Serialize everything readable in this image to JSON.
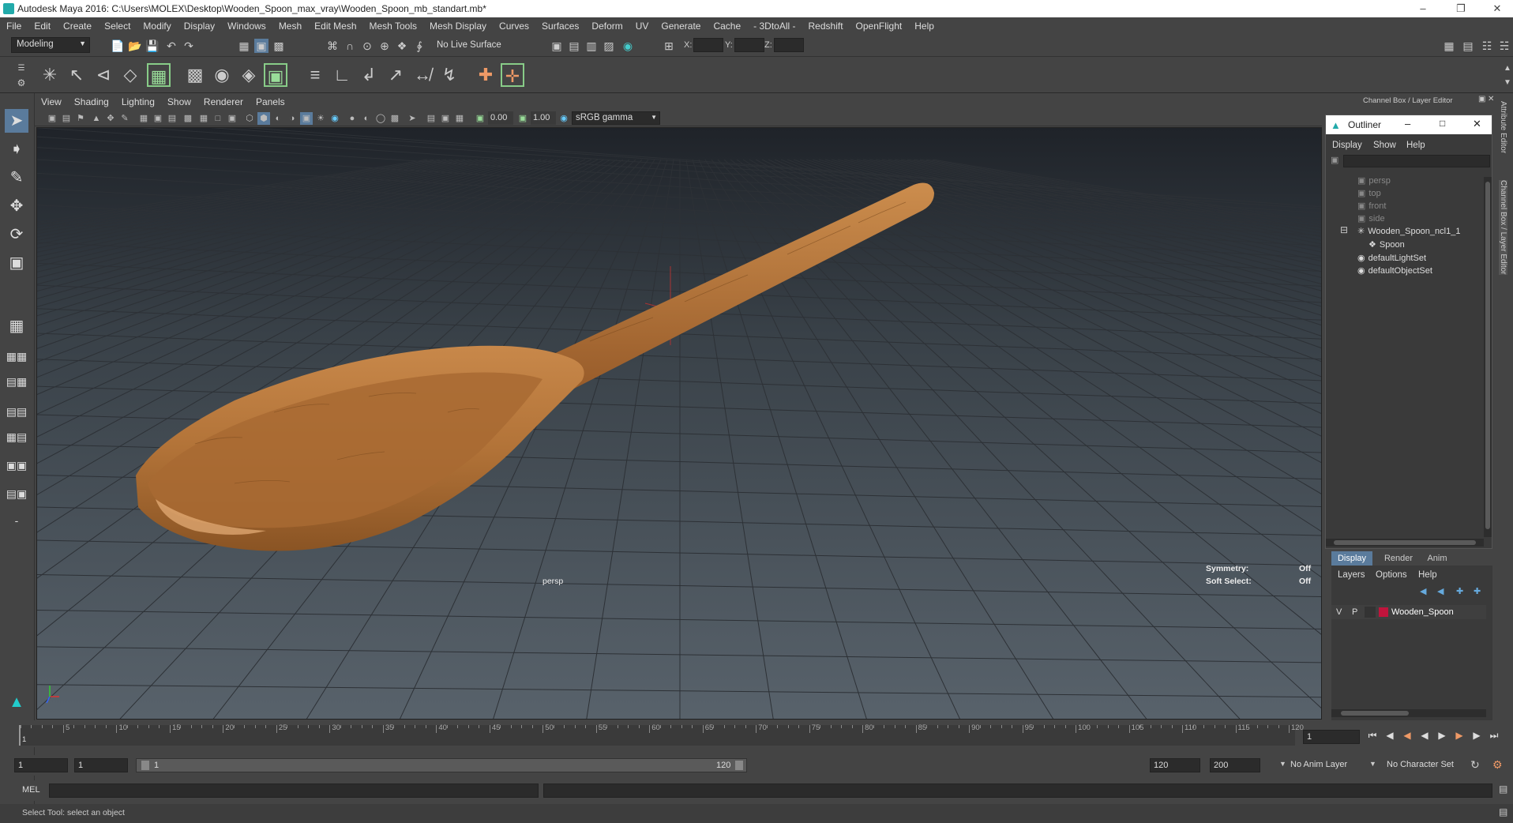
{
  "window": {
    "title": "Autodesk Maya 2016: C:\\Users\\MOLEX\\Desktop\\Wooden_Spoon_max_vray\\Wooden_Spoon_mb_standart.mb*"
  },
  "menubar": [
    "File",
    "Edit",
    "Create",
    "Select",
    "Modify",
    "Display",
    "Windows",
    "Mesh",
    "Edit Mesh",
    "Mesh Tools",
    "Mesh Display",
    "Curves",
    "Surfaces",
    "Deform",
    "UV",
    "Generate",
    "Cache",
    "- 3DtoAll -",
    "Redshift",
    "OpenFlight",
    "Help"
  ],
  "statusline": {
    "mode": "Modeling",
    "live_surface": "No Live Surface",
    "x_label": "X:",
    "y_label": "Y:",
    "z_label": "Z:"
  },
  "panel": {
    "menus": [
      "View",
      "Shading",
      "Lighting",
      "Show",
      "Renderer",
      "Panels"
    ],
    "near_clip": "0.00",
    "exposure": "1.00",
    "color_space": "sRGB gamma"
  },
  "viewport": {
    "camera": "persp",
    "symmetry_label": "Symmetry:",
    "symmetry_value": "Off",
    "soft_select_label": "Soft Select:",
    "soft_select_value": "Off"
  },
  "channelbox": {
    "title": "Channel Box / Layer Editor"
  },
  "outliner": {
    "title": "Outliner",
    "menus": [
      "Display",
      "Show",
      "Help"
    ],
    "items": [
      {
        "label": "persp",
        "dim": true
      },
      {
        "label": "top",
        "dim": true
      },
      {
        "label": "front",
        "dim": true
      },
      {
        "label": "side",
        "dim": true
      },
      {
        "label": "Wooden_Spoon_ncl1_1",
        "dim": false
      },
      {
        "label": "Spoon",
        "dim": false
      },
      {
        "label": "defaultLightSet",
        "dim": false
      },
      {
        "label": "defaultObjectSet",
        "dim": false
      }
    ]
  },
  "layer_editor": {
    "tabs": [
      "Display",
      "Render",
      "Anim"
    ],
    "menus": [
      "Layers",
      "Options",
      "Help"
    ],
    "layer": {
      "v": "V",
      "p": "P",
      "name": "Wooden_Spoon",
      "color": "#c0143c"
    }
  },
  "side_tabs": [
    "Attribute Editor",
    "Channel Box / Layer Editor"
  ],
  "timeline": {
    "ticks": [
      5,
      10,
      15,
      20,
      25,
      30,
      35,
      40,
      45,
      50,
      55,
      60,
      65,
      70,
      75,
      80,
      85,
      90,
      95,
      100,
      105,
      110,
      115,
      120
    ],
    "start_marker": "1",
    "current_frame": "1"
  },
  "range": {
    "start": "1",
    "playback_start": "1",
    "slider_start": "1",
    "slider_end": "120",
    "playback_end": "120",
    "end": "200",
    "anim_layer": "No Anim Layer",
    "character_set": "No Character Set"
  },
  "cmdline": {
    "lang": "MEL"
  },
  "helpline": {
    "text": "Select Tool: select an object"
  }
}
